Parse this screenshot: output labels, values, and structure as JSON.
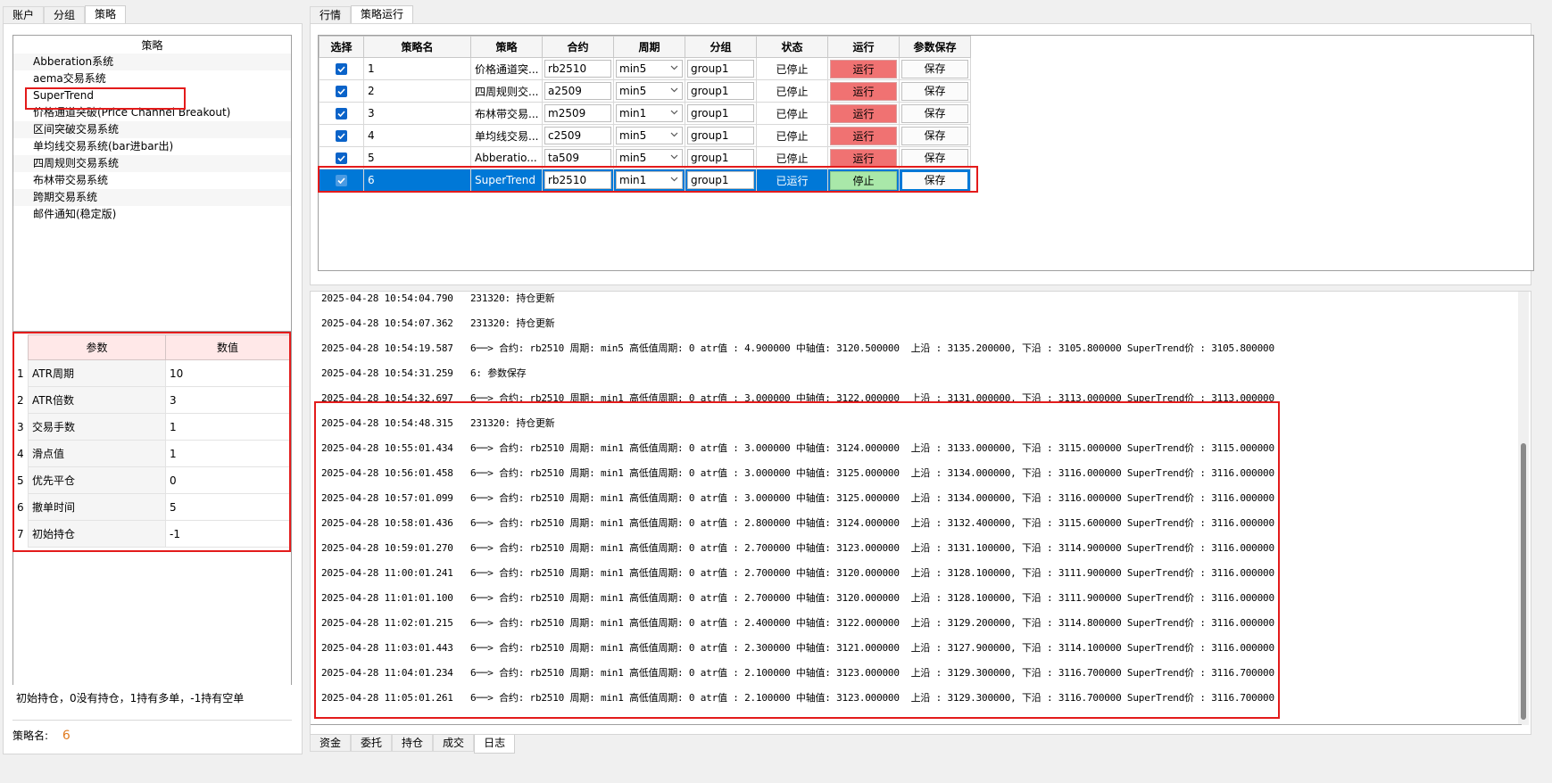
{
  "left_tabs": [
    "账户",
    "分组",
    "策略"
  ],
  "right_tabs": [
    "行情",
    "策略运行"
  ],
  "bottom_tabs": [
    "资金",
    "委托",
    "持仓",
    "成交",
    "日志"
  ],
  "strategy_list": {
    "header": "策略",
    "items": [
      "Abberation系统",
      "aema交易系统",
      "SuperTrend",
      "价格通道突破(Price Channel Breakout)",
      "区间突破交易系统",
      "单均线交易系统(bar进bar出)",
      "四周规则交易系统",
      "布林带交易系统",
      "跨期交易系统",
      "邮件通知(稳定版)"
    ]
  },
  "params": {
    "headers": [
      "参数",
      "数值"
    ],
    "rows": [
      {
        "no": "1",
        "name": "ATR周期",
        "value": "10"
      },
      {
        "no": "2",
        "name": "ATR倍数",
        "value": "3"
      },
      {
        "no": "3",
        "name": "交易手数",
        "value": "1"
      },
      {
        "no": "4",
        "name": "滑点值",
        "value": "1"
      },
      {
        "no": "5",
        "name": "优先平仓",
        "value": "0"
      },
      {
        "no": "6",
        "name": "撤单时间",
        "value": "5"
      },
      {
        "no": "7",
        "name": "初始持仓",
        "value": "-1"
      }
    ]
  },
  "description": "初始持仓，0没有持仓，1持有多单，-1持有空单",
  "strategy_name": {
    "label": "策略名:",
    "value": "6"
  },
  "strategy_table": {
    "headers": [
      "选择",
      "策略名",
      "策略",
      "合约",
      "周期",
      "分组",
      "状态",
      "运行",
      "参数保存"
    ],
    "rows": [
      {
        "name": "1",
        "strategy": "价格通道突...",
        "contract": "rb2510",
        "period": "min5",
        "group": "group1",
        "status": "已停止",
        "run": "运行",
        "save": "保存"
      },
      {
        "name": "2",
        "strategy": "四周规则交...",
        "contract": "a2509",
        "period": "min5",
        "group": "group1",
        "status": "已停止",
        "run": "运行",
        "save": "保存"
      },
      {
        "name": "3",
        "strategy": "布林带交易...",
        "contract": "m2509",
        "period": "min1",
        "group": "group1",
        "status": "已停止",
        "run": "运行",
        "save": "保存"
      },
      {
        "name": "4",
        "strategy": "单均线交易...",
        "contract": "c2509",
        "period": "min5",
        "group": "group1",
        "status": "已停止",
        "run": "运行",
        "save": "保存"
      },
      {
        "name": "5",
        "strategy": "Abberatio...",
        "contract": "ta509",
        "period": "min5",
        "group": "group1",
        "status": "已停止",
        "run": "运行",
        "save": "保存"
      },
      {
        "name": "6",
        "strategy": "SuperTrend",
        "contract": "rb2510",
        "period": "min1",
        "group": "group1",
        "status": "已运行",
        "run": "停止",
        "save": "保存"
      }
    ]
  },
  "log_lines": [
    "2025-04-28 10:54:04.790   231320: 持仓更新",
    "2025-04-28 10:54:07.362   231320: 持仓更新",
    "2025-04-28 10:54:19.587   6──> 合约: rb2510 周期: min5 高低值周期: 0 atr值 : 4.900000 中轴值: 3120.500000  上沿 : 3135.200000, 下沿 : 3105.800000 SuperTrend价 : 3105.800000",
    "2025-04-28 10:54:31.259   6: 参数保存",
    "2025-04-28 10:54:32.697   6──> 合约: rb2510 周期: min1 高低值周期: 0 atr值 : 3.000000 中轴值: 3122.000000  上沿 : 3131.000000, 下沿 : 3113.000000 SuperTrend价 : 3113.000000",
    "2025-04-28 10:54:48.315   231320: 持仓更新",
    "2025-04-28 10:55:01.434   6──> 合约: rb2510 周期: min1 高低值周期: 0 atr值 : 3.000000 中轴值: 3124.000000  上沿 : 3133.000000, 下沿 : 3115.000000 SuperTrend价 : 3115.000000",
    "2025-04-28 10:56:01.458   6──> 合约: rb2510 周期: min1 高低值周期: 0 atr值 : 3.000000 中轴值: 3125.000000  上沿 : 3134.000000, 下沿 : 3116.000000 SuperTrend价 : 3116.000000",
    "2025-04-28 10:57:01.099   6──> 合约: rb2510 周期: min1 高低值周期: 0 atr值 : 3.000000 中轴值: 3125.000000  上沿 : 3134.000000, 下沿 : 3116.000000 SuperTrend价 : 3116.000000",
    "2025-04-28 10:58:01.436   6──> 合约: rb2510 周期: min1 高低值周期: 0 atr值 : 2.800000 中轴值: 3124.000000  上沿 : 3132.400000, 下沿 : 3115.600000 SuperTrend价 : 3116.000000",
    "2025-04-28 10:59:01.270   6──> 合约: rb2510 周期: min1 高低值周期: 0 atr值 : 2.700000 中轴值: 3123.000000  上沿 : 3131.100000, 下沿 : 3114.900000 SuperTrend价 : 3116.000000",
    "2025-04-28 11:00:01.241   6──> 合约: rb2510 周期: min1 高低值周期: 0 atr值 : 2.700000 中轴值: 3120.000000  上沿 : 3128.100000, 下沿 : 3111.900000 SuperTrend价 : 3116.000000",
    "2025-04-28 11:01:01.100   6──> 合约: rb2510 周期: min1 高低值周期: 0 atr值 : 2.700000 中轴值: 3120.000000  上沿 : 3128.100000, 下沿 : 3111.900000 SuperTrend价 : 3116.000000",
    "2025-04-28 11:02:01.215   6──> 合约: rb2510 周期: min1 高低值周期: 0 atr值 : 2.400000 中轴值: 3122.000000  上沿 : 3129.200000, 下沿 : 3114.800000 SuperTrend价 : 3116.000000",
    "2025-04-28 11:03:01.443   6──> 合约: rb2510 周期: min1 高低值周期: 0 atr值 : 2.300000 中轴值: 3121.000000  上沿 : 3127.900000, 下沿 : 3114.100000 SuperTrend价 : 3116.000000",
    "2025-04-28 11:04:01.234   6──> 合约: rb2510 周期: min1 高低值周期: 0 atr值 : 2.100000 中轴值: 3123.000000  上沿 : 3129.300000, 下沿 : 3116.700000 SuperTrend价 : 3116.700000",
    "2025-04-28 11:05:01.261   6──> 合约: rb2510 周期: min1 高低值周期: 0 atr值 : 2.100000 中轴值: 3123.000000  上沿 : 3129.300000, 下沿 : 3116.700000 SuperTrend价 : 3116.700000"
  ],
  "colors": {
    "selected_row": "#0078d7",
    "run_button": "#f07272",
    "stop_button": "#a9e8a9",
    "highlight_box": "#e31b1b",
    "strategy_name_value": "#e07a20"
  },
  "icons": {
    "checkbox": "checkmark-icon",
    "dropdown": "chevron-down-icon"
  }
}
